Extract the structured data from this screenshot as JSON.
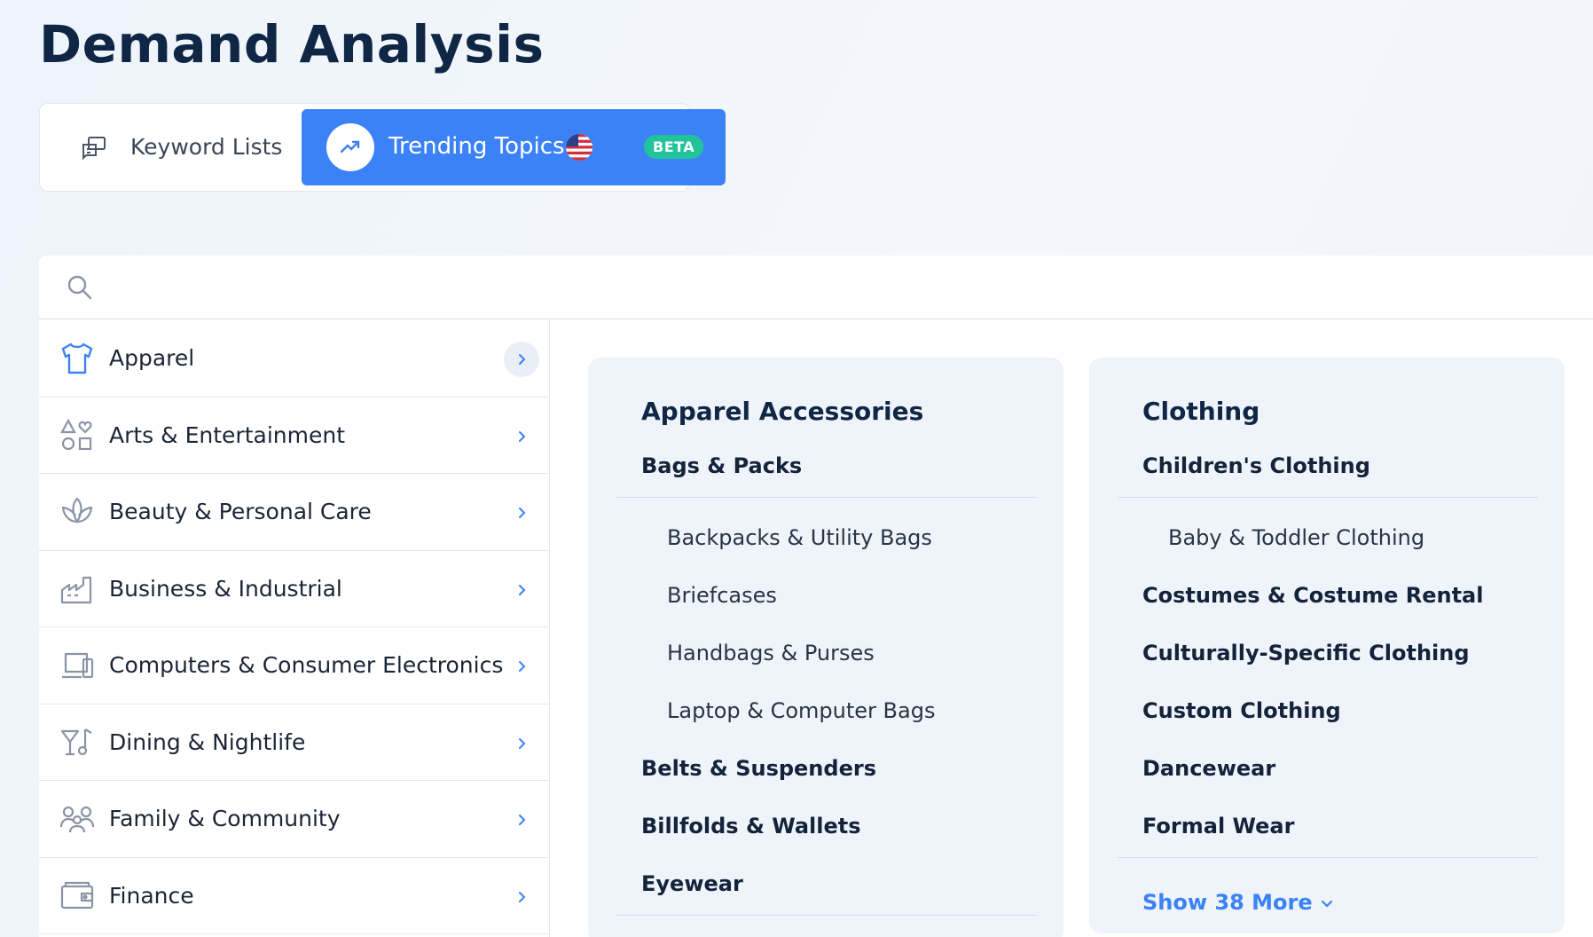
{
  "page_title": "Demand Analysis",
  "tabs": {
    "keyword_lists": "Keyword Lists",
    "trending_topics": "Trending Topics",
    "beta_badge": "BETA",
    "keyword_icon": "keyword-list-icon",
    "trending_icon": "trending-up-icon",
    "flag_icon": "us-flag-icon"
  },
  "search": {
    "placeholder": ""
  },
  "categories": [
    {
      "label": "Apparel",
      "icon": "tshirt-icon",
      "active": true
    },
    {
      "label": "Arts & Entertainment",
      "icon": "shapes-icon"
    },
    {
      "label": "Beauty & Personal Care",
      "icon": "lotus-icon"
    },
    {
      "label": "Business & Industrial",
      "icon": "factory-icon"
    },
    {
      "label": "Computers & Consumer Electronics",
      "icon": "devices-icon"
    },
    {
      "label": "Dining & Nightlife",
      "icon": "cocktail-music-icon"
    },
    {
      "label": "Family & Community",
      "icon": "family-icon"
    },
    {
      "label": "Finance",
      "icon": "wallet-icon"
    }
  ],
  "card_accessories": {
    "title": "Apparel Accessories",
    "items": [
      {
        "label": "Bags & Packs",
        "level": 1
      },
      {
        "label": "Backpacks & Utility Bags",
        "level": 2
      },
      {
        "label": "Briefcases",
        "level": 2
      },
      {
        "label": "Handbags & Purses",
        "level": 2
      },
      {
        "label": "Laptop & Computer Bags",
        "level": 2
      },
      {
        "label": "Belts & Suspenders",
        "level": 1
      },
      {
        "label": "Billfolds & Wallets",
        "level": 1
      },
      {
        "label": "Eyewear",
        "level": 1
      }
    ]
  },
  "card_clothing": {
    "title": "Clothing",
    "items": [
      {
        "label": "Children's Clothing",
        "level": 1
      },
      {
        "label": "Baby & Toddler Clothing",
        "level": 2
      },
      {
        "label": "Costumes & Costume Rental",
        "level": 1
      },
      {
        "label": "Culturally-Specific Clothing",
        "level": 1
      },
      {
        "label": "Custom Clothing",
        "level": 1
      },
      {
        "label": "Dancewear",
        "level": 1
      },
      {
        "label": "Formal Wear",
        "level": 1
      }
    ],
    "show_more": "Show 38 More"
  },
  "colors": {
    "accent": "#3b82f6",
    "beta": "#22c39a",
    "title": "#0f2744"
  }
}
